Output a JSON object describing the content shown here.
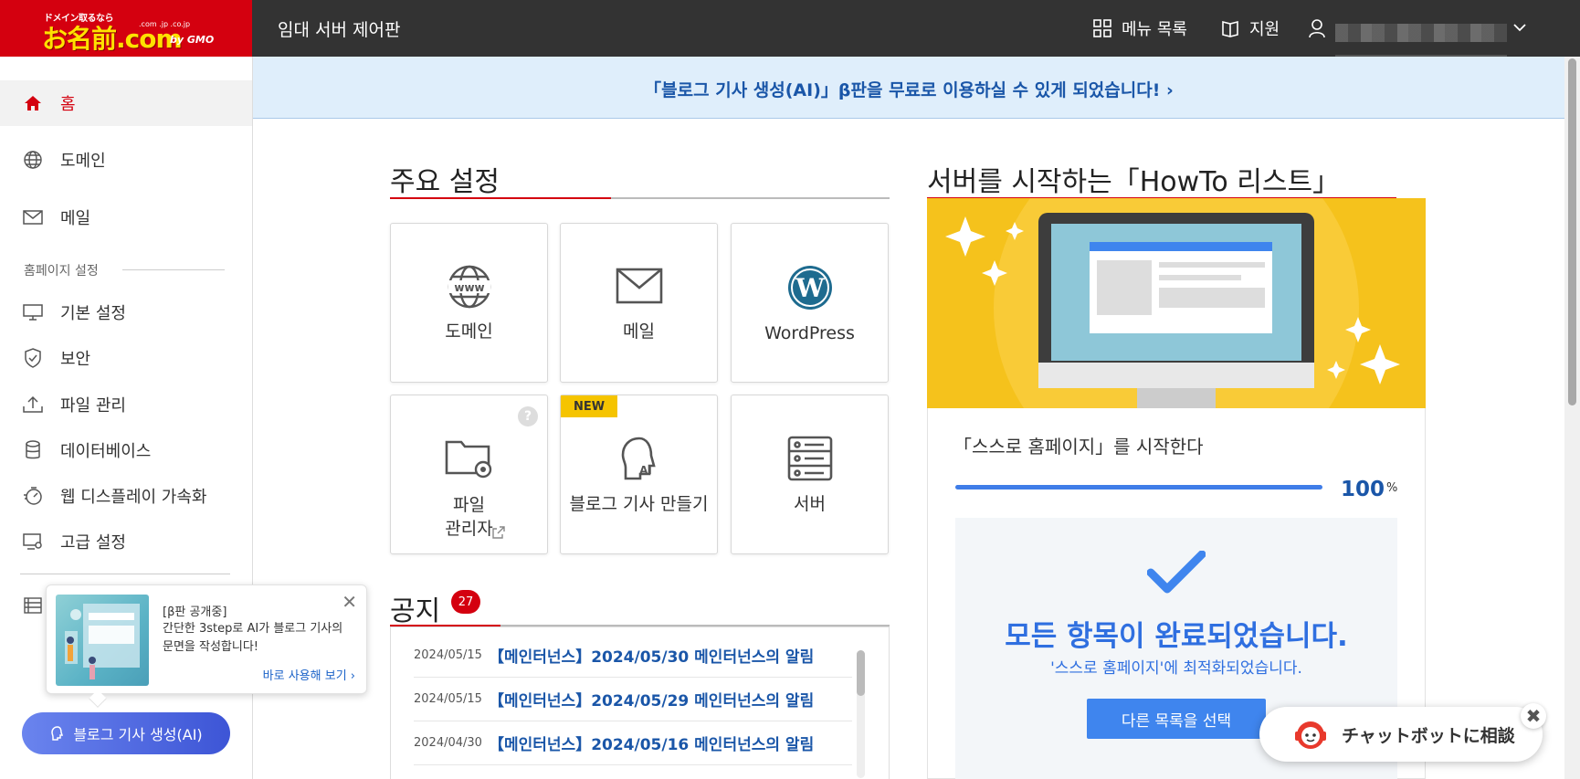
{
  "header": {
    "logo_top": "ドメイン取るなら",
    "logo_main": "お名前.com",
    "logo_domains": ".com .jp .co.jp",
    "logo_by": "by GMO",
    "app_title": "임대 서버 제어판",
    "menu_label": "메뉴 목록",
    "support_label": "지원"
  },
  "sidebar": {
    "items": [
      {
        "label": "홈",
        "icon": "home-icon"
      },
      {
        "label": "도메인",
        "icon": "globe-icon"
      },
      {
        "label": "메일",
        "icon": "mail-icon"
      }
    ],
    "section_label": "홈페이지 설정",
    "section_items": [
      {
        "label": "기본 설정",
        "icon": "monitor-icon"
      },
      {
        "label": "보안",
        "icon": "shield-icon"
      },
      {
        "label": "파일 관리",
        "icon": "upload-icon"
      },
      {
        "label": "데이터베이스",
        "icon": "database-icon"
      },
      {
        "label": "웹 디스플레이 가속화",
        "icon": "speed-icon"
      },
      {
        "label": "고급 설정",
        "icon": "settings-monitor-icon"
      }
    ]
  },
  "popup": {
    "title": "[β판 공개중]",
    "desc": "간단한 3step로 AI가 블로그 기사의 문면을 작성합니다!",
    "link": "바로 사용해 보기 ›"
  },
  "ai_button": "블로그 기사 생성(AI)",
  "banner": "「블로그 기사 생성(AI)」β판을 무료로 이용하실 수 있게 되었습니다! ›",
  "main_settings": {
    "heading": "주요 설정",
    "tiles": [
      {
        "label": "도메인",
        "icon": "www-globe-icon"
      },
      {
        "label": "메일",
        "icon": "envelope-icon"
      },
      {
        "label": "WordPress",
        "icon": "wordpress-icon"
      },
      {
        "label": "파일\n관리자",
        "icon": "folder-gear-icon"
      },
      {
        "label": "블로그 기사 만들기",
        "icon": "ai-head-icon",
        "badge": "NEW"
      },
      {
        "label": "서버",
        "icon": "server-icon"
      }
    ]
  },
  "notices": {
    "heading": "공지",
    "count": "27",
    "items": [
      {
        "date": "2024/05/15",
        "title": "【메인터넌스】2024/05/30 메인터넌스의 알림"
      },
      {
        "date": "2024/05/15",
        "title": "【메인터넌스】2024/05/29 메인터넌스의 알림"
      },
      {
        "date": "2024/04/30",
        "title": "【메인터넌스】2024/05/16 메인터넌스의 알림"
      }
    ]
  },
  "howto": {
    "heading": "서버를 시작하는「HowTo 리스트」",
    "subtitle": "「스스로 홈페이지」를 시작한다",
    "progress": 100,
    "progress_label": "100",
    "progress_unit": "%",
    "done_title": "모든 항목이 완료되었습니다.",
    "done_desc": "'스스로 홈페이지'에 최적화되었습니다.",
    "select_button": "다른 목록을 선택"
  },
  "chatbot": {
    "label": "チャットボットに相談"
  },
  "colors": {
    "brand_red": "#d4000f",
    "header_dark": "#333333",
    "link_blue": "#1a56a8",
    "accent_blue": "#3f85ee",
    "howto_yellow": "#f5c21c"
  }
}
